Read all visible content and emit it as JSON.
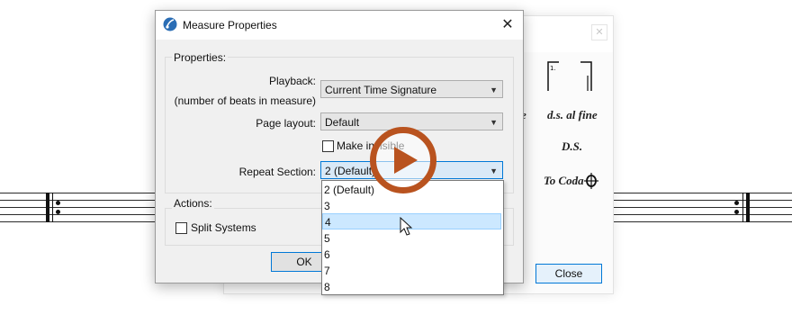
{
  "dialog": {
    "title": "Measure Properties",
    "close_glyph": "✕",
    "properties_group_label": "Properties:",
    "playback_label": "Playback:",
    "playback_sublabel": "(number of beats in measure)",
    "playback_value": "Current Time Signature",
    "page_layout_label": "Page layout:",
    "page_layout_value": "Default",
    "make_invisible_label": "Make invisible",
    "repeat_section_label": "Repeat Section:",
    "repeat_section_value": "2 (Default)",
    "actions_group_label": "Actions:",
    "split_systems_label": "Split Systems",
    "ok_label": "OK"
  },
  "dropdown": {
    "options": [
      "2 (Default)",
      "3",
      "4",
      "5",
      "6",
      "7",
      "8"
    ],
    "highlighted_index": 2
  },
  "palette": {
    "close_glyph": "✕",
    "italic_partial": "e",
    "ds_al_fine": "d.s. al fine",
    "ds": "D.S.",
    "to_coda": "To Coda",
    "close_label": "Close"
  },
  "colors": {
    "accent": "#0078d7",
    "play_overlay": "#b9531f",
    "highlight": "#cce8ff"
  }
}
